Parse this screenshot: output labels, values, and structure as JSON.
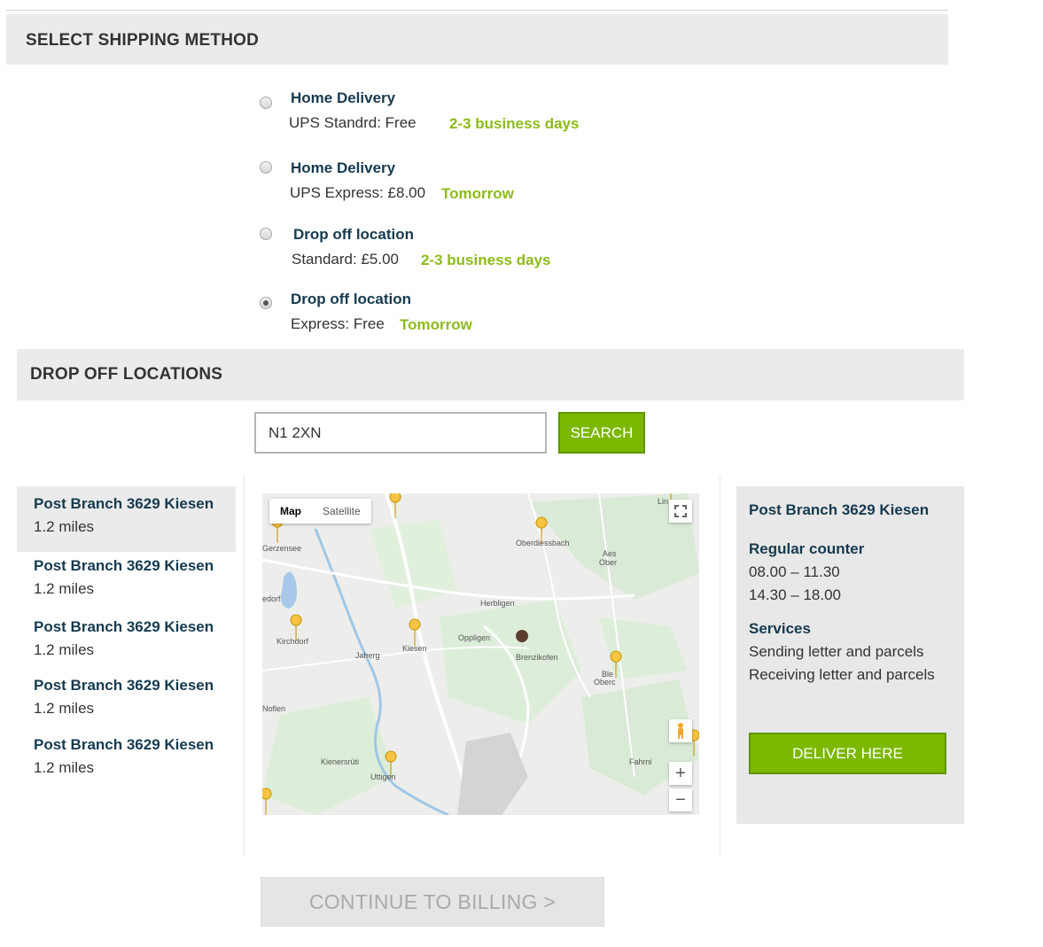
{
  "shipping": {
    "title": "SELECT SHIPPING METHOD",
    "options": [
      {
        "title": "Home Delivery",
        "price": "UPS Standrd: Free",
        "eta": "2-3 business days",
        "selected": false
      },
      {
        "title": "Home Delivery",
        "price": "UPS Express: £8.00",
        "eta": "Tomorrow",
        "selected": false
      },
      {
        "title": "Drop off location",
        "price": "Standard: £5.00",
        "eta": "2-3 business days",
        "selected": false
      },
      {
        "title": "Drop off location",
        "price": "Express: Free",
        "eta": "Tomorrow",
        "selected": true
      }
    ]
  },
  "dropoff": {
    "title": "DROP OFF LOCATIONS",
    "search_value": "N1 2XN",
    "search_label": "SEARCH",
    "locations": [
      {
        "name": "Post Branch 3629 Kiesen",
        "distance": "1.2 miles"
      },
      {
        "name": "Post Branch 3629 Kiesen",
        "distance": "1.2 miles"
      },
      {
        "name": "Post Branch 3629 Kiesen",
        "distance": "1.2 miles"
      },
      {
        "name": "Post Branch 3629 Kiesen",
        "distance": "1.2 miles"
      },
      {
        "name": "Post Branch 3629 Kiesen",
        "distance": "1.2 miles"
      }
    ]
  },
  "map": {
    "tab_map": "Map",
    "tab_satellite": "Satellite",
    "labels": [
      "Gerzensee",
      "Oberdiessbach",
      "Herbligen",
      "Kirchdorf",
      "Jaberg",
      "Kiesen",
      "Oppligen",
      "Brenzikofen",
      "Noflen",
      "Kienersrüti",
      "Uttigen",
      "Fahrni",
      "Aes",
      "Ober",
      "edorf",
      "Lin",
      "Ble",
      "Oberc"
    ]
  },
  "details": {
    "name": "Post Branch 3629 Kiesen",
    "counter_title": "Regular counter",
    "hours": [
      "08.00 – 11.30",
      "14.30 – 18.00"
    ],
    "services_title": "Services",
    "services": [
      "Sending letter and parcels",
      "Receiving letter and parcels"
    ],
    "deliver_label": "DELIVER HERE"
  },
  "continue_label": "CONTINUE TO BILLING >",
  "colors": {
    "accent_green": "#7cb800",
    "eta_green": "#8cbb1a",
    "navy": "#163a4f"
  }
}
